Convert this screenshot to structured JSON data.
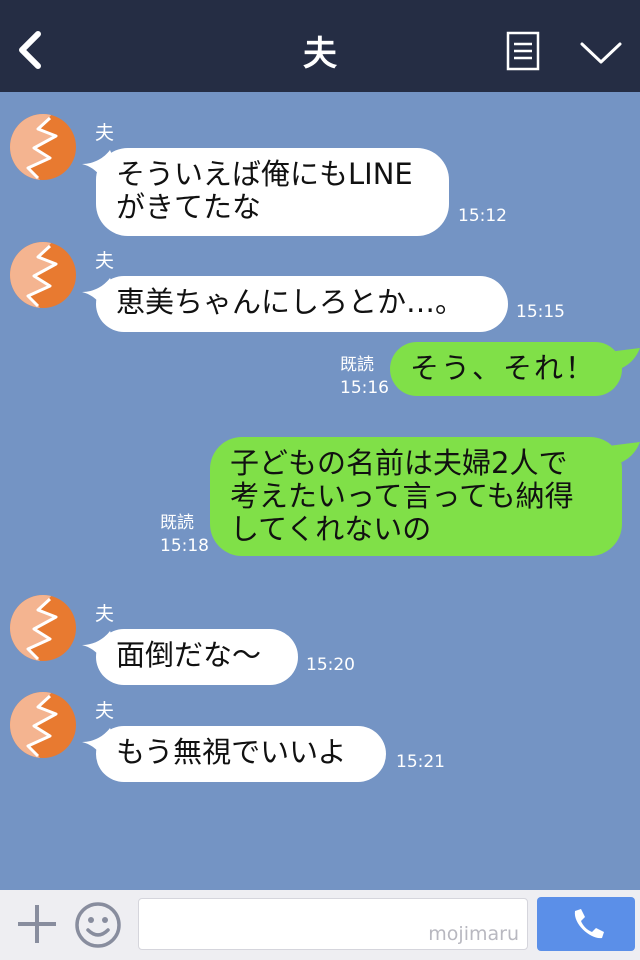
{
  "header": {
    "title": "夫"
  },
  "contact": {
    "name": "夫"
  },
  "messages": [
    {
      "dir": "in",
      "text": "そういえば俺にもLINE\nがきてたな",
      "time": "15:12"
    },
    {
      "dir": "in",
      "text": "恵美ちゃんにしろとか…。",
      "time": "15:15"
    },
    {
      "dir": "out",
      "text": "そう、それ！",
      "read": "既読",
      "time": "15:16"
    },
    {
      "dir": "out",
      "text": "子どもの名前は夫婦2人で\n考えたいって言っても納得\nしてくれないの",
      "read": "既読",
      "time": "15:18"
    },
    {
      "dir": "in",
      "text": "面倒だな〜",
      "time": "15:20"
    },
    {
      "dir": "in",
      "text": "もう無視でいいよ",
      "time": "15:21"
    }
  ],
  "footer": {
    "watermark": "mojimaru"
  },
  "icons": {
    "back": "chevron-left-icon",
    "menu": "list-icon",
    "collapse": "chevron-down-icon",
    "add": "plus-icon",
    "sticker": "smiley-icon",
    "call": "phone-icon"
  },
  "colors": {
    "header": "#252d44",
    "background": "#7494c4",
    "outgoing": "#80e048",
    "incoming": "#ffffff",
    "call": "#5b8fe8"
  }
}
